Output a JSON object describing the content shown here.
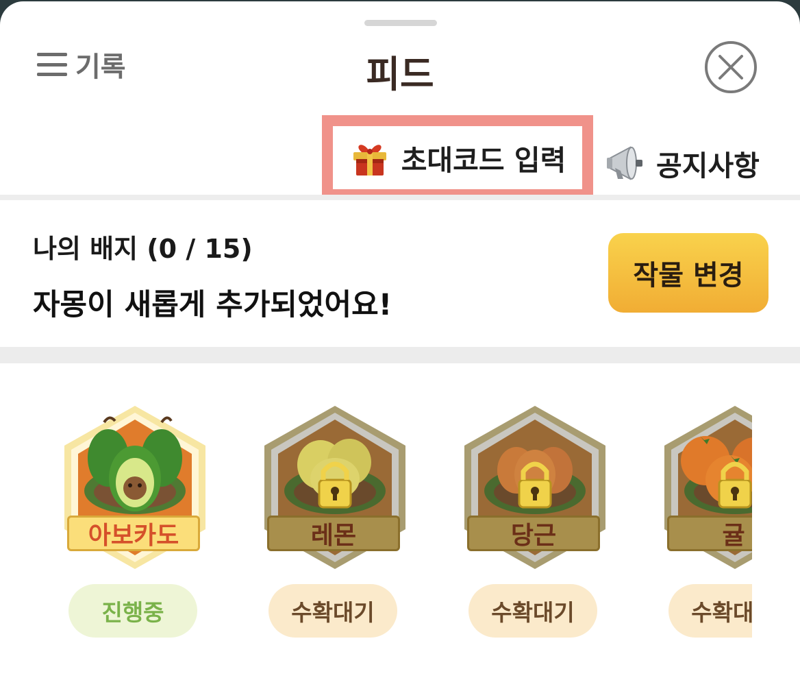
{
  "header": {
    "menu_label": "기록",
    "title": "피드"
  },
  "links": {
    "invite_label": "초대코드 입력",
    "notice_label": "공지사항"
  },
  "badges": {
    "count_text": "나의 배지 (0 / 15)",
    "message": "자몽이 새롭게 추가되었어요!",
    "change_button": "작물 변경"
  },
  "crops": [
    {
      "name": "아보카도",
      "status": "진행중",
      "locked": false,
      "icon": "avocado-icon"
    },
    {
      "name": "레몬",
      "status": "수확대기",
      "locked": true,
      "icon": "lemon-icon"
    },
    {
      "name": "당근",
      "status": "수확대기",
      "locked": true,
      "icon": "carrot-icon"
    },
    {
      "name": "귤",
      "status": "수확대기",
      "locked": true,
      "icon": "tangerine-icon"
    }
  ],
  "colors": {
    "invite_highlight": "#f0928a",
    "change_button": "#f5c13f",
    "active_status_bg": "#eef5d6",
    "active_status_text": "#7ab24a",
    "waiting_status_bg": "#fbeacb",
    "waiting_status_text": "#6b4a2a"
  }
}
